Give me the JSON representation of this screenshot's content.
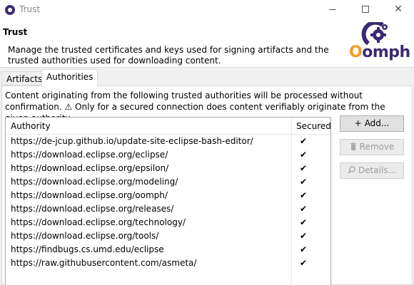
{
  "window": {
    "title": "Trust"
  },
  "header": {
    "title": "Trust",
    "description": "Manage the trusted certificates and keys used for signing artifacts and the trusted authorities used for downloading content.",
    "logo_text_o": "O",
    "logo_text_rest": "omph"
  },
  "tabs": [
    {
      "label": "Artifacts",
      "selected": false
    },
    {
      "label": "Authorities",
      "selected": true
    }
  ],
  "panel": {
    "message": "Content originating from the following trusted authorities will be processed without confirmation. ⚠ Only for a secured connection does content verifiably originate from the given authority."
  },
  "table": {
    "columns": [
      "Authority",
      "Secured"
    ],
    "rows": [
      {
        "url": "https://de-jcup.github.io/update-site-eclipse-bash-editor/",
        "secured": "✔"
      },
      {
        "url": "https://download.eclipse.org/eclipse/",
        "secured": "✔"
      },
      {
        "url": "https://download.eclipse.org/epsilon/",
        "secured": "✔"
      },
      {
        "url": "https://download.eclipse.org/modeling/",
        "secured": "✔"
      },
      {
        "url": "https://download.eclipse.org/oomph/",
        "secured": "✔"
      },
      {
        "url": "https://download.eclipse.org/releases/",
        "secured": "✔"
      },
      {
        "url": "https://download.eclipse.org/technology/",
        "secured": "✔"
      },
      {
        "url": "https://download.eclipse.org/tools/",
        "secured": "✔"
      },
      {
        "url": "https://findbugs.cs.umd.edu/eclipse",
        "secured": "✔"
      },
      {
        "url": "https://raw.githubusercontent.com/asmeta/",
        "secured": "✔"
      }
    ]
  },
  "buttons": {
    "add_label": "Add...",
    "add_icon": "+",
    "remove_label": "Remove",
    "remove_icon": "trash-icon",
    "details_label": "Details...",
    "details_icon": "magnifier-icon"
  },
  "colors": {
    "logo_orange": "#f39c21",
    "logo_purple": "#3b2a72"
  }
}
